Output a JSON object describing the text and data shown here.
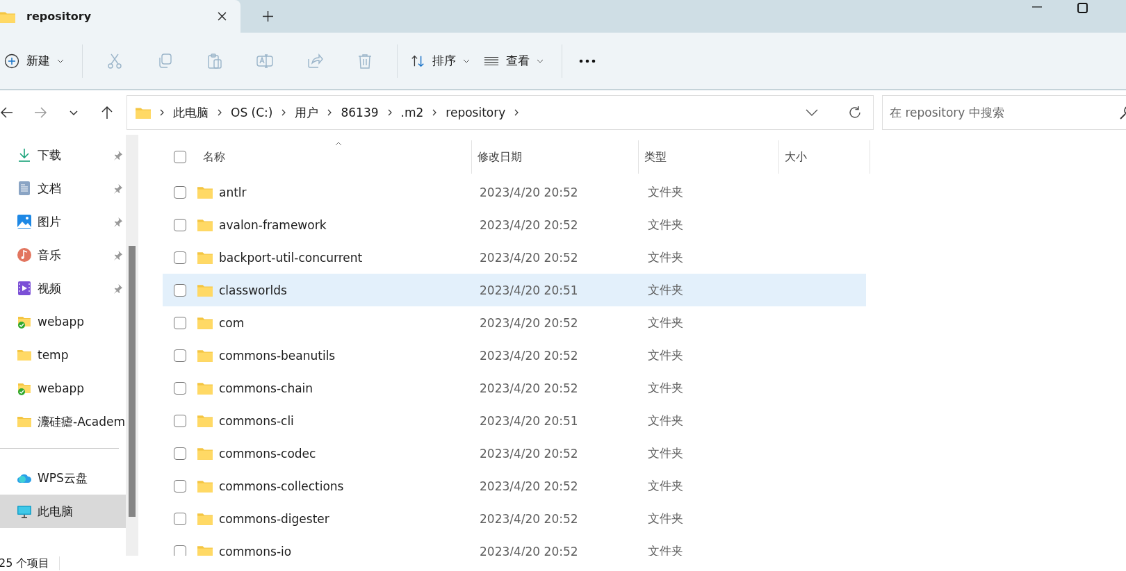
{
  "tab": {
    "title": "repository",
    "selected": true
  },
  "toolbar": {
    "new_label": "新建",
    "actions": [
      {
        "kind": "cut",
        "disabled": true
      },
      {
        "kind": "copy",
        "disabled": true
      },
      {
        "kind": "paste",
        "disabled": true
      },
      {
        "kind": "rename",
        "disabled": true
      },
      {
        "kind": "share",
        "disabled": true
      },
      {
        "kind": "delete",
        "disabled": true
      }
    ],
    "sort_label": "排序",
    "view_label": "查看"
  },
  "nav": [
    {
      "kind": "back",
      "disabled": false
    },
    {
      "kind": "forward",
      "disabled": true
    },
    {
      "kind": "recent",
      "disabled": false
    },
    {
      "kind": "up",
      "disabled": false
    }
  ],
  "breadcrumbs": [
    "此电脑",
    "OS (C:)",
    "用户",
    "86139",
    ".m2",
    "repository"
  ],
  "search": {
    "placeholder": "在 repository 中搜索"
  },
  "sidebar": {
    "quick_access": [
      {
        "label": "下载",
        "kind": "download",
        "pinned": true,
        "selected": false
      },
      {
        "label": "文档",
        "kind": "document",
        "pinned": true,
        "selected": false
      },
      {
        "label": "图片",
        "kind": "pictures",
        "pinned": true,
        "selected": false
      },
      {
        "label": "音乐",
        "kind": "music",
        "pinned": true,
        "selected": false
      },
      {
        "label": "视频",
        "kind": "video",
        "pinned": true,
        "selected": false
      },
      {
        "label": "webapp",
        "kind": "synced-folder",
        "pinned": false,
        "selected": false
      },
      {
        "label": "temp",
        "kind": "folder",
        "pinned": false,
        "selected": false
      },
      {
        "label": "webapp",
        "kind": "synced-folder",
        "pinned": false,
        "selected": false
      },
      {
        "label": "灋硅瘧-Academ",
        "kind": "folder",
        "pinned": false,
        "selected": false
      }
    ],
    "locations": [
      {
        "label": "WPS云盘",
        "kind": "cloud",
        "selected": false
      },
      {
        "label": "此电脑",
        "kind": "computer",
        "selected": true
      }
    ]
  },
  "table": {
    "select_all_checked": false,
    "columns": [
      {
        "label": "名称",
        "sorted": true
      },
      {
        "label": "修改日期",
        "sorted": false
      },
      {
        "label": "类型",
        "sorted": false
      },
      {
        "label": "大小",
        "sorted": false
      }
    ],
    "rows": [
      {
        "name": "antlr",
        "modified": "2023/4/20 20:52",
        "type": "文件夹",
        "selected": false,
        "checked": false
      },
      {
        "name": "avalon-framework",
        "modified": "2023/4/20 20:52",
        "type": "文件夹",
        "selected": false,
        "checked": false
      },
      {
        "name": "backport-util-concurrent",
        "modified": "2023/4/20 20:52",
        "type": "文件夹",
        "selected": false,
        "checked": false
      },
      {
        "name": "classworlds",
        "modified": "2023/4/20 20:51",
        "type": "文件夹",
        "selected": true,
        "checked": false
      },
      {
        "name": "com",
        "modified": "2023/4/20 20:52",
        "type": "文件夹",
        "selected": false,
        "checked": false
      },
      {
        "name": "commons-beanutils",
        "modified": "2023/4/20 20:52",
        "type": "文件夹",
        "selected": false,
        "checked": false
      },
      {
        "name": "commons-chain",
        "modified": "2023/4/20 20:52",
        "type": "文件夹",
        "selected": false,
        "checked": false
      },
      {
        "name": "commons-cli",
        "modified": "2023/4/20 20:51",
        "type": "文件夹",
        "selected": false,
        "checked": false
      },
      {
        "name": "commons-codec",
        "modified": "2023/4/20 20:52",
        "type": "文件夹",
        "selected": false,
        "checked": false
      },
      {
        "name": "commons-collections",
        "modified": "2023/4/20 20:52",
        "type": "文件夹",
        "selected": false,
        "checked": false
      },
      {
        "name": "commons-digester",
        "modified": "2023/4/20 20:52",
        "type": "文件夹",
        "selected": false,
        "checked": false
      },
      {
        "name": "commons-io",
        "modified": "2023/4/20 20:52",
        "type": "文件夹",
        "selected": false,
        "checked": false
      }
    ]
  },
  "status_bar": {
    "item_count": "25 个项目"
  }
}
